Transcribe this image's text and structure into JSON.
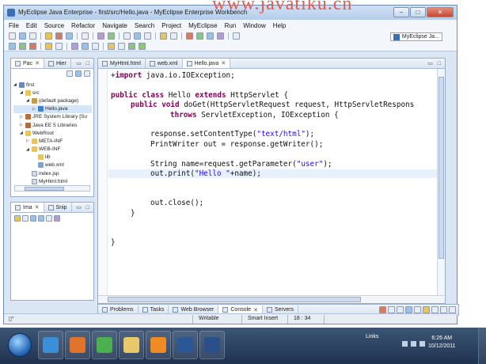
{
  "watermark": "www.javatiku.cn",
  "window": {
    "title": "MyEclipse Java Enterprise - first/src/Hello.java - MyEclipse Enterprise Workbench",
    "minimize": "–",
    "maximize": "□",
    "close": "✕"
  },
  "menu": [
    "File",
    "Edit",
    "Source",
    "Refactor",
    "Navigate",
    "Search",
    "Project",
    "MyEclipse",
    "Run",
    "Window",
    "Help"
  ],
  "perspective": {
    "label": "MyEclipse Ja..."
  },
  "package_panel": {
    "tabs": [
      {
        "label": "Pac",
        "close": "✕"
      },
      {
        "label": "Hier",
        "close": ""
      }
    ],
    "controls": "▭ □",
    "tree": [
      {
        "arrow": "◢",
        "icon": "proj",
        "label": "first"
      },
      {
        "arrow": "◢",
        "icon": "folder",
        "label": "src"
      },
      {
        "arrow": "◢",
        "icon": "pkg",
        "label": "(default package)"
      },
      {
        "arrow": "▷",
        "icon": "java",
        "label": "Hello.java"
      },
      {
        "arrow": "▷",
        "icon": "lib",
        "label": "JRE System Library [Su"
      },
      {
        "arrow": "▷",
        "icon": "lib",
        "label": "Java EE 5 Libraries"
      },
      {
        "arrow": "◢",
        "icon": "folder",
        "label": "WebRoot"
      },
      {
        "arrow": "▷",
        "icon": "folder",
        "label": "META-INF"
      },
      {
        "arrow": "◢",
        "icon": "folder",
        "label": "WEB-INF"
      },
      {
        "arrow": "",
        "icon": "folder",
        "label": "lib"
      },
      {
        "arrow": "",
        "icon": "xml",
        "label": "web.xml"
      },
      {
        "arrow": "",
        "icon": "file",
        "label": "index.jsp"
      },
      {
        "arrow": "",
        "icon": "file",
        "label": "MyHtml.html"
      }
    ]
  },
  "image_panel": {
    "tabs": [
      {
        "label": "Ima",
        "close": "✕"
      },
      {
        "label": "Snip",
        "close": ""
      }
    ],
    "controls": "▭ □"
  },
  "editor": {
    "tabs": [
      {
        "label": "MyHtml.html",
        "close": ""
      },
      {
        "label": "web.xml",
        "close": ""
      },
      {
        "label": "Hello.java",
        "close": "✕"
      }
    ],
    "controls": "▭ □",
    "lines": [
      {
        "parts": [
          {
            "t": "+",
            "k": ""
          },
          {
            "t": "import",
            "k": "kw"
          },
          {
            "t": " java.io.IOException;",
            "k": ""
          }
        ],
        "indent": 0
      },
      {
        "parts": [],
        "indent": 0
      },
      {
        "parts": [
          {
            "t": "public",
            "k": "kw"
          },
          {
            "t": " ",
            "k": ""
          },
          {
            "t": "class",
            "k": "kw"
          },
          {
            "t": " Hello ",
            "k": ""
          },
          {
            "t": "extends",
            "k": "kw"
          },
          {
            "t": " HttpServlet {",
            "k": ""
          }
        ],
        "indent": 0
      },
      {
        "parts": [
          {
            "t": "public",
            "k": "kw"
          },
          {
            "t": " ",
            "k": ""
          },
          {
            "t": "void",
            "k": "kw"
          },
          {
            "t": " doGet(HttpServletRequest request, HttpServletRespons",
            "k": ""
          }
        ],
        "indent": 1
      },
      {
        "parts": [
          {
            "t": "throws",
            "k": "kw"
          },
          {
            "t": " ServletException, IOException {",
            "k": ""
          }
        ],
        "indent": 3
      },
      {
        "parts": [],
        "indent": 0
      },
      {
        "parts": [
          {
            "t": "response.setContentType(",
            "k": ""
          },
          {
            "t": "\"text/html\"",
            "k": "str"
          },
          {
            "t": ");",
            "k": ""
          }
        ],
        "indent": 2
      },
      {
        "parts": [
          {
            "t": "PrintWriter out = response.getWriter();",
            "k": ""
          }
        ],
        "indent": 2
      },
      {
        "parts": [],
        "indent": 0
      },
      {
        "parts": [
          {
            "t": "String name=request.getParameter(",
            "k": ""
          },
          {
            "t": "\"user\"",
            "k": "str"
          },
          {
            "t": ");",
            "k": ""
          }
        ],
        "indent": 2
      },
      {
        "parts": [
          {
            "t": "out.print(",
            "k": ""
          },
          {
            "t": "\"Hello \"",
            "k": "str"
          },
          {
            "t": "+name);",
            "k": ""
          }
        ],
        "indent": 2,
        "current": true
      },
      {
        "parts": [],
        "indent": 0
      },
      {
        "parts": [],
        "indent": 0
      },
      {
        "parts": [
          {
            "t": "out.close();",
            "k": ""
          }
        ],
        "indent": 2
      },
      {
        "parts": [
          {
            "t": "}",
            "k": ""
          }
        ],
        "indent": 1
      },
      {
        "parts": [],
        "indent": 0
      },
      {
        "parts": [],
        "indent": 0
      },
      {
        "parts": [
          {
            "t": "}",
            "k": ""
          }
        ],
        "indent": 0
      }
    ]
  },
  "console_panel": {
    "tabs": [
      {
        "label": "Problems",
        "close": ""
      },
      {
        "label": "Tasks",
        "close": ""
      },
      {
        "label": "Web Browser",
        "close": ""
      },
      {
        "label": "Console",
        "close": "✕"
      },
      {
        "label": "Servers",
        "close": ""
      }
    ]
  },
  "status": {
    "left_icon": "▯°",
    "writable": "Writable",
    "insert_mode": "Smart Insert",
    "position": "18 : 34"
  },
  "taskbar": {
    "links_label": "Links",
    "time": "6:26 AM",
    "date": "10/12/2011",
    "apps": [
      {
        "name": "internet-explorer",
        "color": "#3b8fd6"
      },
      {
        "name": "firefox",
        "color": "#e0742b"
      },
      {
        "name": "chrome",
        "color": "#4caf50"
      },
      {
        "name": "file-explorer",
        "color": "#e8c86a"
      },
      {
        "name": "media-player",
        "color": "#f08a24"
      },
      {
        "name": "word",
        "color": "#2b5797"
      },
      {
        "name": "myeclipse",
        "color": "#2a4f8a"
      }
    ]
  }
}
